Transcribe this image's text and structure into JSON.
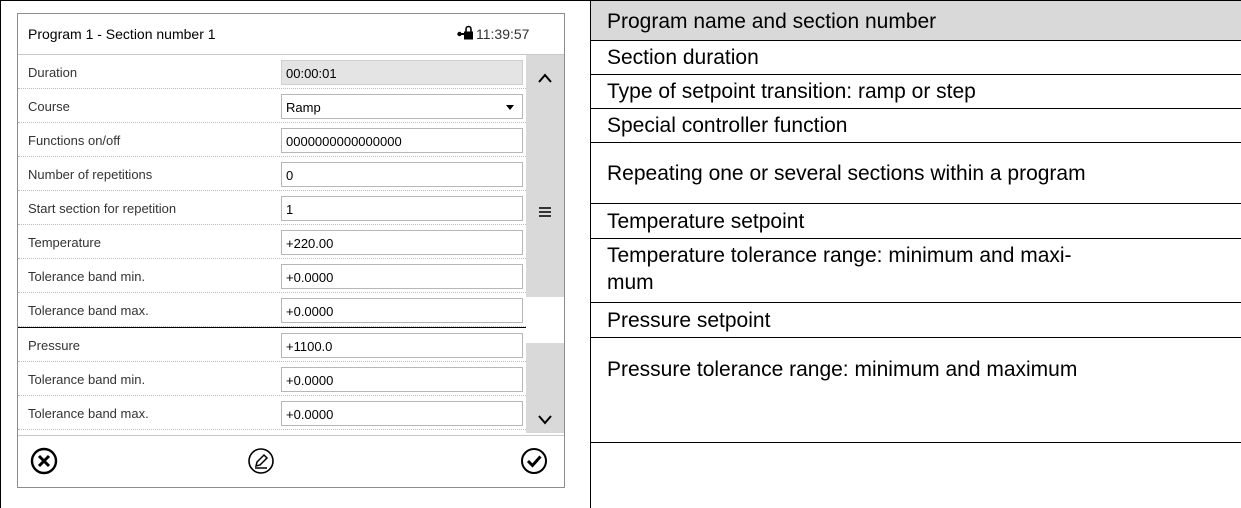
{
  "screen": {
    "title": "Program 1 - Section number 1",
    "time": "11:39:57",
    "rows": [
      {
        "label": "Duration",
        "value": "00:00:01",
        "readonly": true
      },
      {
        "label": "Course",
        "value": "Ramp",
        "dropdown": true
      },
      {
        "label": "Functions on/off",
        "value": "0000000000000000"
      },
      {
        "label": "Number of repetitions",
        "value": "0"
      },
      {
        "label": "Start section for repetition",
        "value": "1"
      },
      {
        "label": "Temperature",
        "value": "+220.00"
      },
      {
        "label": "Tolerance band min.",
        "value": "+0.0000"
      },
      {
        "label": "Tolerance band max.",
        "value": "+0.0000"
      },
      {
        "label": "Pressure",
        "value": "+1100.0"
      },
      {
        "label": "Tolerance band min.",
        "value": "+0.0000"
      },
      {
        "label": "Tolerance band max.",
        "value": "+0.0000"
      }
    ]
  },
  "descriptions": [
    "Program name and section number",
    "Section duration",
    "Type of setpoint transition: ramp or step",
    "Special controller function",
    "Repeating one or several sections within a program",
    "Temperature setpoint",
    "Temperature tolerance range: minimum and maxi-",
    "mum",
    "Pressure setpoint",
    "Pressure tolerance range: minimum and maximum"
  ],
  "icons": {
    "lock": "lock-icon",
    "scroll_up": "chevron-up-icon",
    "scroll_menu": "menu-icon",
    "scroll_down": "chevron-down-icon",
    "cancel": "cancel-icon",
    "edit": "edit-icon",
    "confirm": "confirm-icon"
  },
  "colors": {
    "header_bg": "#d9d9d9",
    "readonly_field": "#e4e4e4",
    "scrollbar": "#d9d9d9"
  }
}
